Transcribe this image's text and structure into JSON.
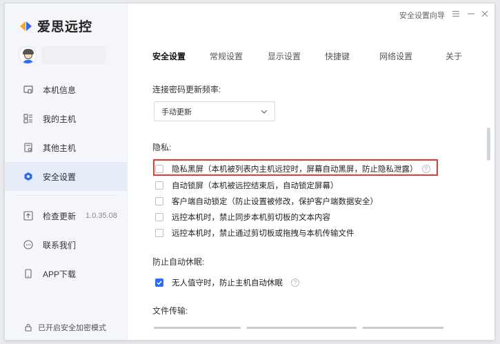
{
  "app": {
    "name": "爱思远控"
  },
  "titlebar": {
    "guide_label": "安全设置向导",
    "menu_icon": "menu-icon",
    "min_icon": "minimize-icon",
    "close_icon": "close-icon"
  },
  "sidebar": {
    "items": [
      {
        "label": "本机信息",
        "icon": "monitor-icon"
      },
      {
        "label": "我的主机",
        "icon": "grid-icon"
      },
      {
        "label": "其他主机",
        "icon": "device-icon"
      },
      {
        "label": "安全设置",
        "icon": "shield-icon",
        "active": true
      }
    ],
    "bottom_items": [
      {
        "label": "检查更新",
        "version": "1.0.35.08",
        "icon": "upload-icon"
      },
      {
        "label": "联系我们",
        "icon": "chat-icon"
      },
      {
        "label": "APP下载",
        "icon": "phone-icon"
      }
    ],
    "safe_mode_label": "已开启安全加密模式"
  },
  "tabs": [
    {
      "label": "安全设置",
      "active": true
    },
    {
      "label": "常规设置"
    },
    {
      "label": "显示设置"
    },
    {
      "label": "快捷键"
    },
    {
      "label": "网络设置"
    },
    {
      "label": "关于"
    }
  ],
  "settings": {
    "password_freq_label": "连接密码更新频率:",
    "password_freq_value": "手动更新",
    "privacy_label": "隐私:",
    "privacy_options": [
      {
        "label": "隐私黑屏（本机被列表内主机远控时，屏幕自动黑屏，防止隐私泄露）",
        "checked": false,
        "help": true
      },
      {
        "label": "自动锁屏（本机被远控结束后，自动锁定屏幕）",
        "checked": false
      },
      {
        "label": "客户端自动锁定（防止设置被修改，保护客户端数据安全）",
        "checked": false
      },
      {
        "label": "远控本机时，禁止同步本机剪切板的文本内容",
        "checked": false
      },
      {
        "label": "远控本机时，禁止通过剪切板或拖拽与本机传输文件",
        "checked": false
      }
    ],
    "sleep_label": "防止自动休眠:",
    "sleep_option": {
      "label": "无人值守时，防止主机自动休眠",
      "checked": true,
      "help": true
    },
    "file_label": "文件传输:"
  },
  "colors": {
    "accent": "#2b6cf6",
    "highlight": "#e53935",
    "sidebar_bg": "#f4f6fa",
    "active_bg": "#e6ecf8"
  }
}
